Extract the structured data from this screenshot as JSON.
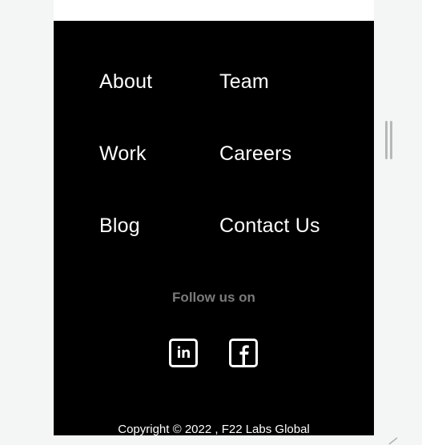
{
  "footer": {
    "links": [
      {
        "label": "About"
      },
      {
        "label": "Team"
      },
      {
        "label": "Work"
      },
      {
        "label": "Careers"
      },
      {
        "label": "Blog"
      },
      {
        "label": "Contact Us"
      }
    ],
    "follow_text": "Follow us on",
    "social": [
      {
        "icon": "linkedin-icon"
      },
      {
        "icon": "facebook-icon"
      }
    ],
    "copyright": "Copyright © 2022 , F22 Labs Global"
  },
  "colors": {
    "footer_bg": "#000000",
    "link_text": "#ffffff",
    "follow_text": "#7a7a7a",
    "page_bg": "#f4f5f5"
  }
}
